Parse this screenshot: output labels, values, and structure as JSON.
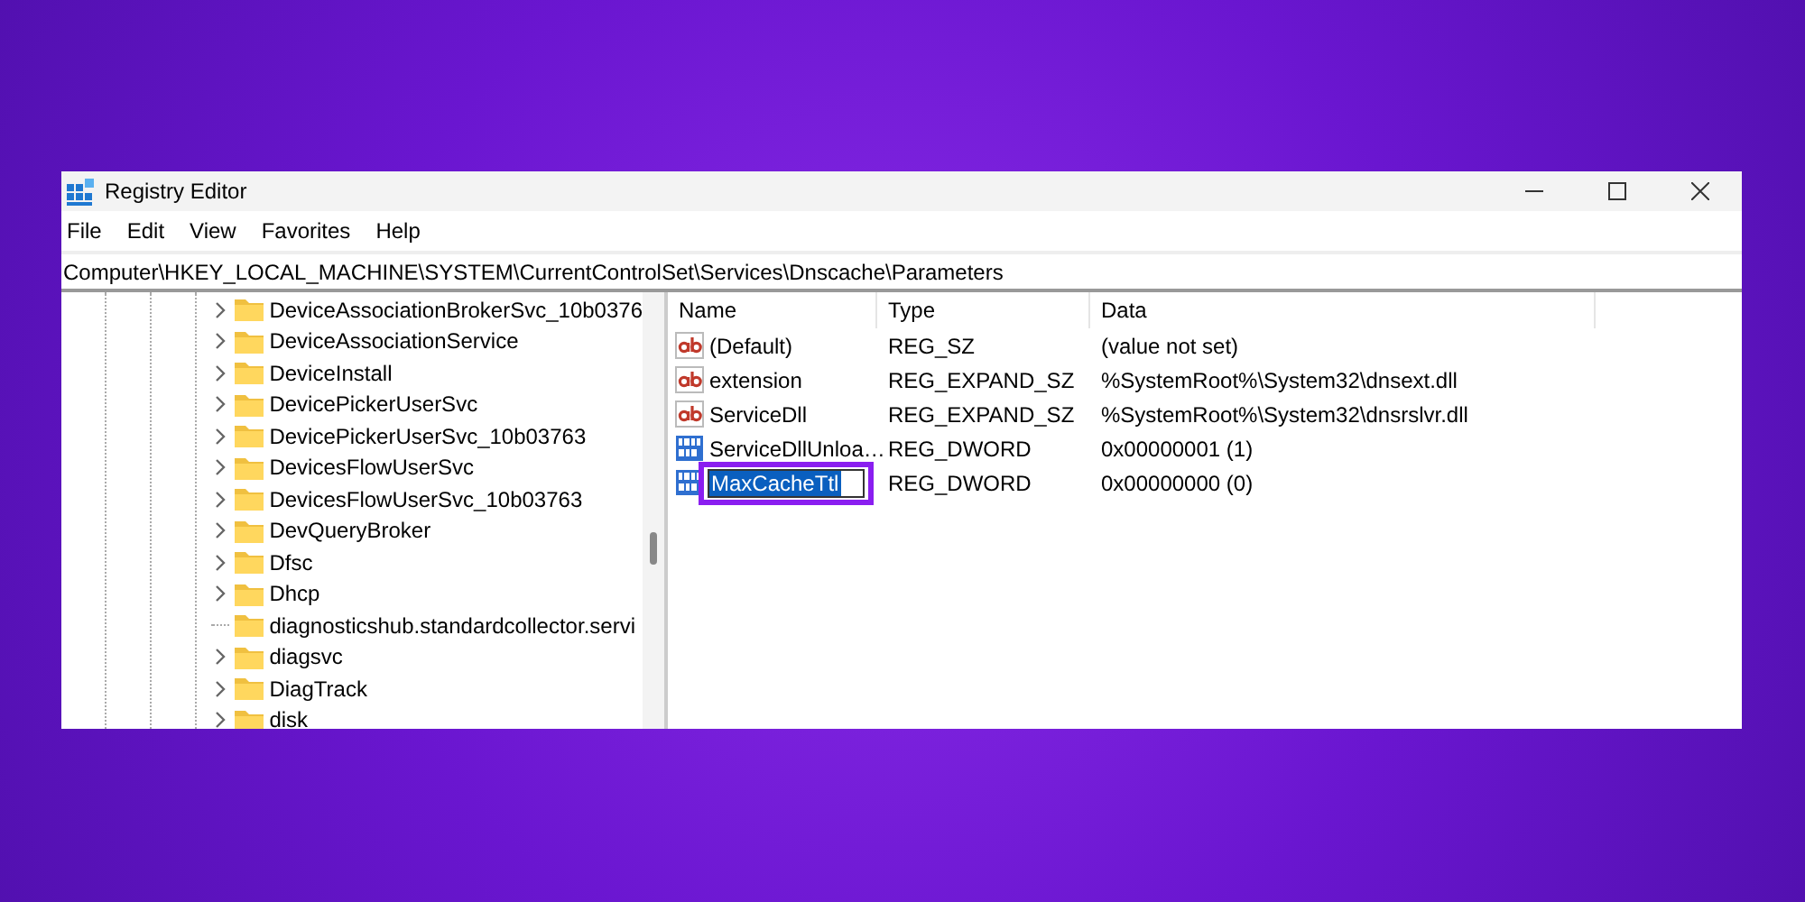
{
  "window": {
    "title": "Registry Editor"
  },
  "menu": [
    "File",
    "Edit",
    "View",
    "Favorites",
    "Help"
  ],
  "address": "Computer\\HKEY_LOCAL_MACHINE\\SYSTEM\\CurrentControlSet\\Services\\Dnscache\\Parameters",
  "tree": {
    "items": [
      {
        "label": "DeviceAssociationBrokerSvc_10b0376",
        "expandable": true
      },
      {
        "label": "DeviceAssociationService",
        "expandable": true
      },
      {
        "label": "DeviceInstall",
        "expandable": true
      },
      {
        "label": "DevicePickerUserSvc",
        "expandable": true
      },
      {
        "label": "DevicePickerUserSvc_10b03763",
        "expandable": true
      },
      {
        "label": "DevicesFlowUserSvc",
        "expandable": true
      },
      {
        "label": "DevicesFlowUserSvc_10b03763",
        "expandable": true
      },
      {
        "label": "DevQueryBroker",
        "expandable": true
      },
      {
        "label": "Dfsc",
        "expandable": true
      },
      {
        "label": "Dhcp",
        "expandable": true
      },
      {
        "label": "diagnosticshub.standardcollector.servi",
        "expandable": false
      },
      {
        "label": "diagsvc",
        "expandable": true
      },
      {
        "label": "DiagTrack",
        "expandable": true
      },
      {
        "label": "disk",
        "expandable": true
      }
    ]
  },
  "values": {
    "columns": [
      "Name",
      "Type",
      "Data"
    ],
    "rows": [
      {
        "kind": "string",
        "name": "(Default)",
        "type": "REG_SZ",
        "data": "(value not set)",
        "editing": false
      },
      {
        "kind": "string",
        "name": "extension",
        "type": "REG_EXPAND_SZ",
        "data": "%SystemRoot%\\System32\\dnsext.dll",
        "editing": false
      },
      {
        "kind": "string",
        "name": "ServiceDll",
        "type": "REG_EXPAND_SZ",
        "data": "%SystemRoot%\\System32\\dnsrslvr.dll",
        "editing": false
      },
      {
        "kind": "binary",
        "name": "ServiceDllUnloa…",
        "type": "REG_DWORD",
        "data": "0x00000001 (1)",
        "editing": false
      },
      {
        "kind": "binary",
        "name": "MaxCacheTtl",
        "type": "REG_DWORD",
        "data": "0x00000000 (0)",
        "editing": true
      }
    ]
  }
}
